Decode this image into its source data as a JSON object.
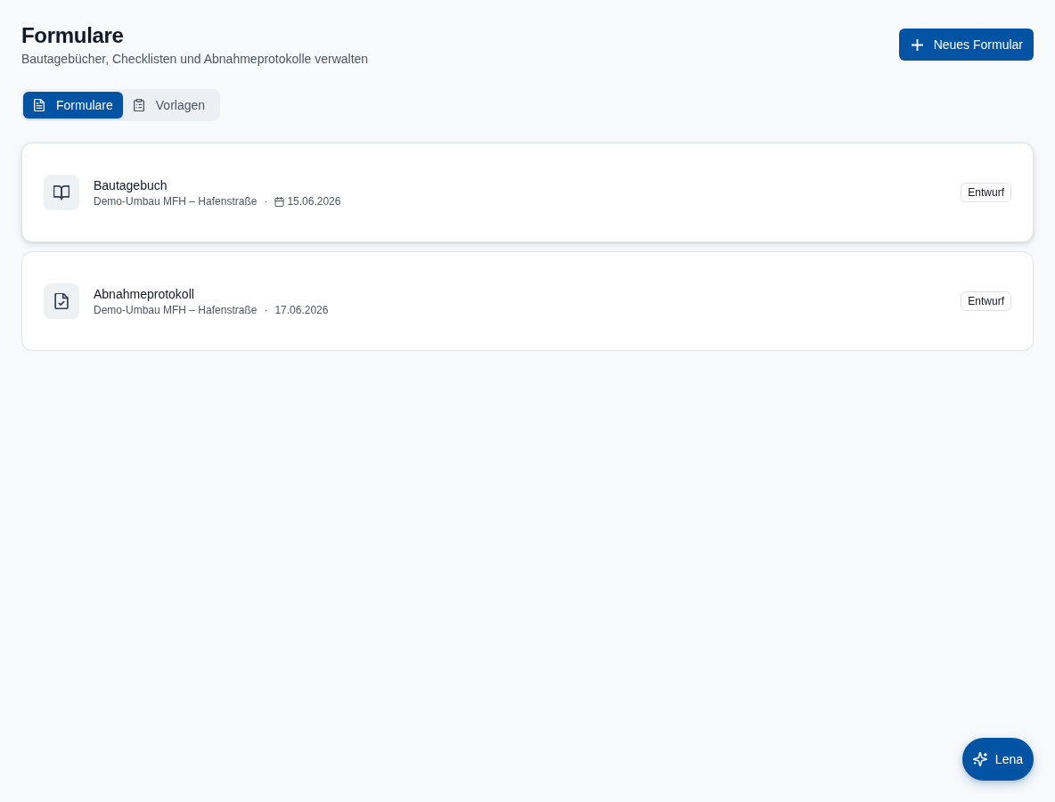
{
  "header": {
    "title": "Formulare",
    "subtitle": "Bautagebücher, Checklisten und Abnahmeprotokolle verwalten",
    "new_button": {
      "label": "Neues Formular"
    }
  },
  "tabs": [
    {
      "label": "Formulare",
      "kind": "document",
      "selected": true
    },
    {
      "label": "Vorlagen",
      "kind": "clipboard",
      "selected": false
    }
  ],
  "forms": [
    {
      "title": "Bautagebuch",
      "kind": "diary",
      "project": "Demo-Umbau MFH – Hafenstraße",
      "separator": "·",
      "date": "15.06.2026",
      "date_icon": true,
      "hovered": true,
      "status": "Entwurf"
    },
    {
      "title": "Abnahmeprotokoll",
      "kind": "protocol",
      "project": "Demo-Umbau MFH – Hafenstraße",
      "separator": "·",
      "date": "17.06.2026",
      "date_icon": false,
      "hovered": false,
      "status": "Entwurf"
    }
  ],
  "assistant_button": {
    "label": "Lena"
  }
}
